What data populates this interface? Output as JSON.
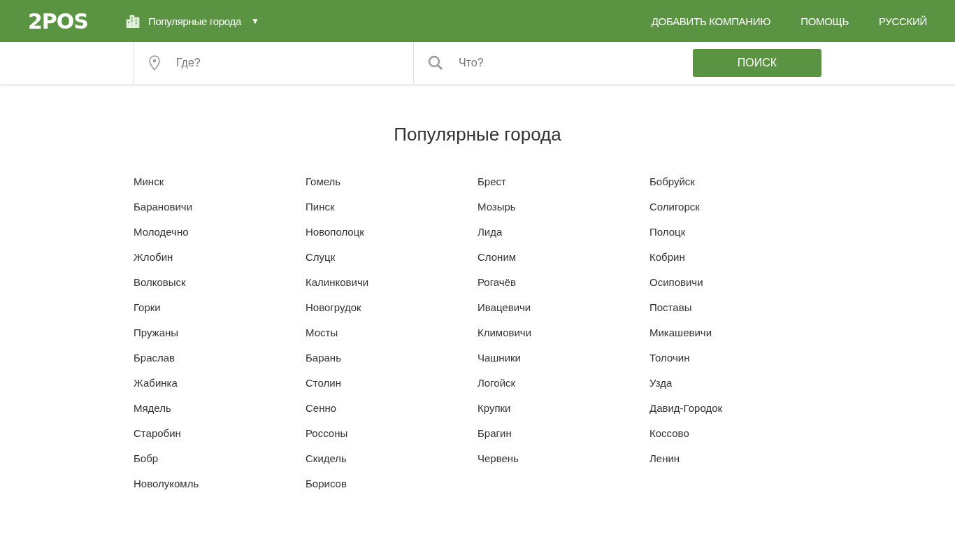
{
  "header": {
    "logo": "2POS",
    "city_menu": "Популярные города",
    "city_menu_caret": "▼",
    "nav": [
      "ДОБАВИТЬ КОМПАНИЮ",
      "ПОМОЩЬ",
      "РУССКИЙ"
    ]
  },
  "search": {
    "where_placeholder": "Где?",
    "what_placeholder": "Что?",
    "button": "ПОИСК"
  },
  "title": "Популярные города",
  "columns": [
    [
      "Минск",
      "Барановичи",
      "Молодечно",
      "Жлобин",
      "Волковыск",
      "Горки",
      "Пружаны",
      "Браслав",
      "Жабинка",
      "Мядель",
      "Старобин",
      "Бобр",
      "Новолукомль"
    ],
    [
      "Гомель",
      "Пинск",
      "Новополоцк",
      "Слуцк",
      "Калинковичи",
      "Новогрудок",
      "Мосты",
      "Барань",
      "Столин",
      "Сенно",
      "Россоны",
      "Скидель",
      "Борисов"
    ],
    [
      "Брест",
      "Мозырь",
      "Лида",
      "Слоним",
      "Рогачёв",
      "Ивацевичи",
      "Климовичи",
      "Чашники",
      "Логойск",
      "Крупки",
      "Брагин",
      "Червень"
    ],
    [
      "Бобруйск",
      "Солигорск",
      "Полоцк",
      "Кобрин",
      "Осиповичи",
      "Поставы",
      "Микашевичи",
      "Толочин",
      "Узда",
      "Давид-Городок",
      "Коссово",
      "Ленин"
    ]
  ]
}
